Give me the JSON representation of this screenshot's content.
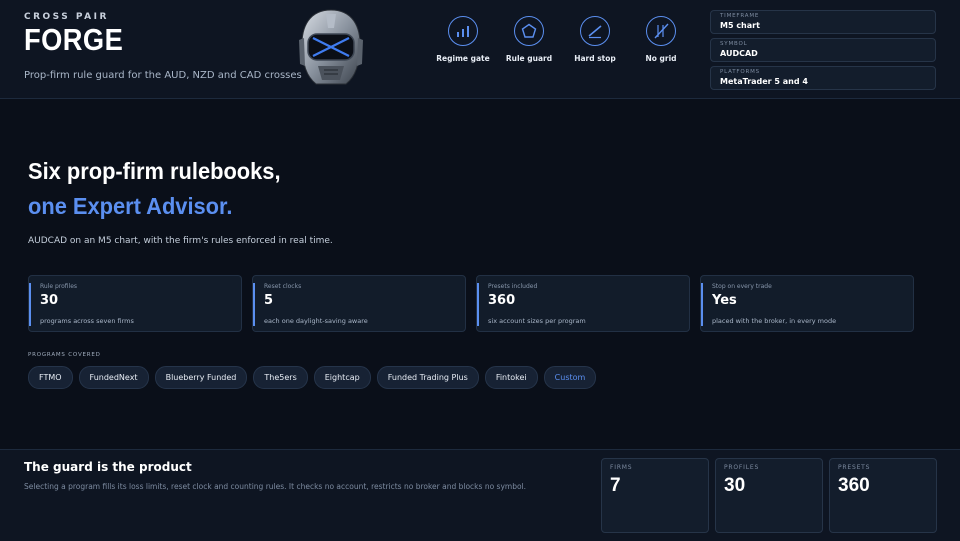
{
  "header": {
    "eyebrow": "CROSS PAIR",
    "brand": "FORGE",
    "tagline": "Prop-firm rule guard for the AUD, NZD and CAD crosses",
    "features": [
      {
        "label": "Regime gate",
        "icon": "bar-chart-icon"
      },
      {
        "label": "Rule guard",
        "icon": "pentagon-shield-icon"
      },
      {
        "label": "Hard stop",
        "icon": "slash-line-icon"
      },
      {
        "label": "No grid",
        "icon": "no-grid-icon"
      }
    ],
    "info": [
      {
        "key": "TIMEFRAME",
        "value": "M5 chart"
      },
      {
        "key": "SYMBOL",
        "value": "AUDCAD"
      },
      {
        "key": "PLATFORMS",
        "value": "MetaTrader 5 and 4"
      }
    ]
  },
  "hero": {
    "headline1": "Six prop-firm rulebooks,",
    "headline2": "one Expert Advisor.",
    "subline": "AUDCAD on an M5 chart, with the firm's rules enforced in real time."
  },
  "stats": [
    {
      "key": "Rule profiles",
      "value": "30",
      "desc": "programs across seven firms"
    },
    {
      "key": "Reset clocks",
      "value": "5",
      "desc": "each one daylight-saving aware"
    },
    {
      "key": "Presets included",
      "value": "360",
      "desc": "six account sizes per program"
    },
    {
      "key": "Stop on every trade",
      "value": "Yes",
      "desc": "placed with the broker, in every mode"
    }
  ],
  "programs": {
    "label": "PROGRAMS COVERED",
    "items": [
      "FTMO",
      "FundedNext",
      "Blueberry Funded",
      "The5ers",
      "Eightcap",
      "Funded Trading Plus",
      "Fintokei",
      "Custom"
    ]
  },
  "footer": {
    "title": "The guard is the product",
    "text": "Selecting a program fills its loss limits, reset clock and counting rules. It checks no account, restricts no broker and blocks no symbol.",
    "boxes": [
      {
        "key": "FIRMS",
        "value": "7"
      },
      {
        "key": "PROFILES",
        "value": "30"
      },
      {
        "key": "PRESETS",
        "value": "360"
      }
    ]
  },
  "colors": {
    "accent": "#5b8ff0",
    "background": "#0a0f19",
    "panel": "#121c2a"
  }
}
